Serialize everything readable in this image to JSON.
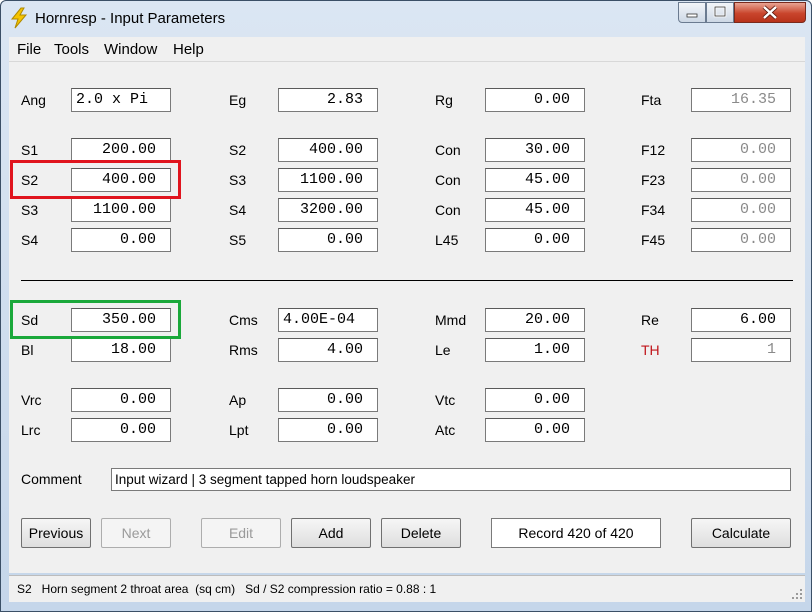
{
  "window": {
    "title": "Hornresp - Input Parameters",
    "icon": "lightning-bolt-icon"
  },
  "menu": [
    "File",
    "Tools",
    "Window",
    "Help"
  ],
  "params": {
    "Ang": {
      "label": "Ang",
      "value": "2.0 x Pi"
    },
    "Eg": {
      "label": "Eg",
      "value": "2.83"
    },
    "Rg": {
      "label": "Rg",
      "value": "0.00"
    },
    "Fta": {
      "label": "Fta",
      "value": "16.35"
    },
    "S1": {
      "label": "S1",
      "value": "200.00"
    },
    "S2": {
      "label": "S2",
      "value": "400.00"
    },
    "S3": {
      "label": "S3",
      "value": "1100.00"
    },
    "S4": {
      "label": "S4",
      "value": "0.00"
    },
    "S2b": {
      "label": "S2",
      "value": "400.00"
    },
    "S3b": {
      "label": "S3",
      "value": "1100.00"
    },
    "S4b": {
      "label": "S4",
      "value": "3200.00"
    },
    "S5": {
      "label": "S5",
      "value": "0.00"
    },
    "Con1": {
      "label": "Con",
      "value": "30.00"
    },
    "Con2": {
      "label": "Con",
      "value": "45.00"
    },
    "Con3": {
      "label": "Con",
      "value": "45.00"
    },
    "L45": {
      "label": "L45",
      "value": "0.00"
    },
    "F12": {
      "label": "F12",
      "value": "0.00"
    },
    "F23": {
      "label": "F23",
      "value": "0.00"
    },
    "F34": {
      "label": "F34",
      "value": "0.00"
    },
    "F45": {
      "label": "F45",
      "value": "0.00"
    },
    "Sd": {
      "label": "Sd",
      "value": "350.00"
    },
    "Bl": {
      "label": "Bl",
      "value": "18.00"
    },
    "Cms": {
      "label": "Cms",
      "value": "4.00E-04"
    },
    "Rms": {
      "label": "Rms",
      "value": "4.00"
    },
    "Mmd": {
      "label": "Mmd",
      "value": "20.00"
    },
    "Le": {
      "label": "Le",
      "value": "1.00"
    },
    "Re": {
      "label": "Re",
      "value": "6.00"
    },
    "TH": {
      "label": "TH",
      "value": "1"
    },
    "Vrc": {
      "label": "Vrc",
      "value": "0.00"
    },
    "Lrc": {
      "label": "Lrc",
      "value": "0.00"
    },
    "Ap": {
      "label": "Ap",
      "value": "0.00"
    },
    "Lpt": {
      "label": "Lpt",
      "value": "0.00"
    },
    "Vtc": {
      "label": "Vtc",
      "value": "0.00"
    },
    "Atc": {
      "label": "Atc",
      "value": "0.00"
    }
  },
  "comment": {
    "label": "Comment",
    "value": "Input wizard | 3 segment tapped horn loudspeaker"
  },
  "buttons": {
    "previous": "Previous",
    "next": "Next",
    "edit": "Edit",
    "add": "Add",
    "delete": "Delete",
    "calculate": "Calculate"
  },
  "record": "Record 420 of 420",
  "status": "S2   Horn segment 2 throat area  (sq cm)   Sd / S2 compression ratio = 0.88 : 1",
  "colors": {
    "highlight_red": "#e0141e",
    "highlight_green": "#1aa83a",
    "th_label": "#c0141a"
  }
}
